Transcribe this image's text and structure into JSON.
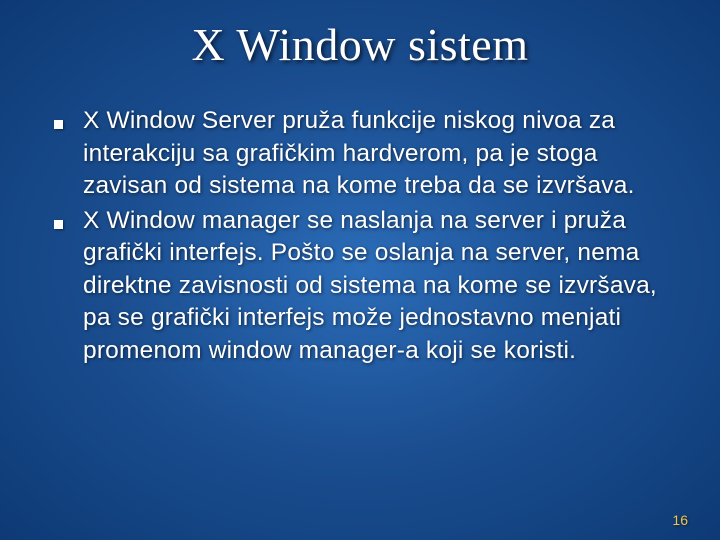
{
  "slide": {
    "title": "X Window sistem",
    "bullets": [
      "X Window Server pruža funkcije niskog nivoa za interakciju sa grafičkim hardverom, pa je stoga zavisan od sistema na kome treba da se izvršava.",
      "X Window manager se naslanja na server i pruža grafički interfejs. Pošto se oslanja na server, nema direktne zavisnosti od sistema na kome se izvršava, pa se grafički interfejs može jednostavno menjati promenom window manager-a koji se koristi."
    ],
    "page_number": "16"
  }
}
